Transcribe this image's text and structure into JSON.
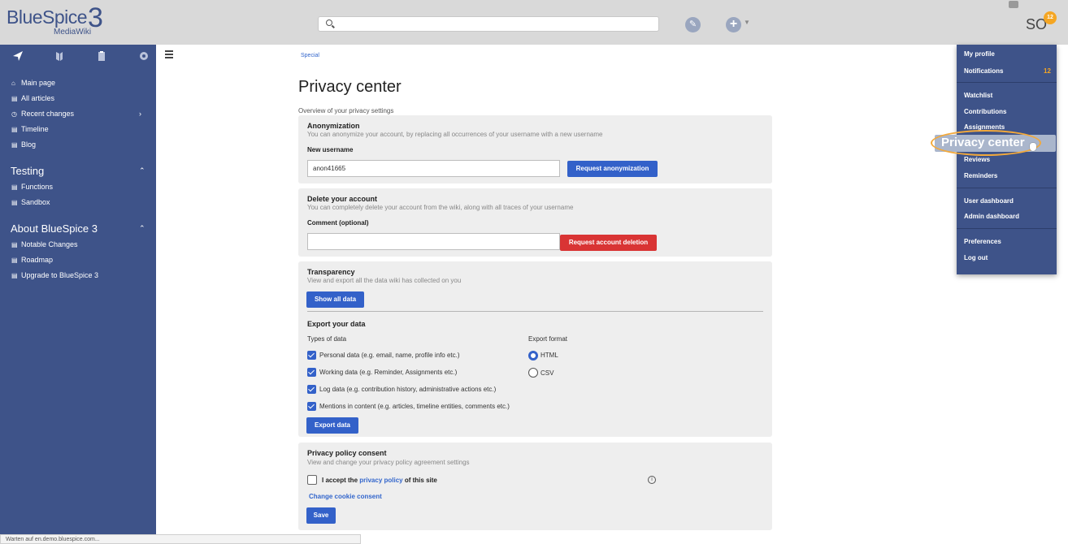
{
  "header": {
    "logo_text": "BlueSpice",
    "logo_number": "3",
    "logo_sub": "MediaWiki",
    "search_placeholder": "",
    "avatar_initials": "SO",
    "notification_count": "12"
  },
  "sidebar": {
    "items": [
      {
        "label": "Main page",
        "icon": "home-icon"
      },
      {
        "label": "All articles",
        "icon": "page-icon"
      },
      {
        "label": "Recent changes",
        "icon": "clock-icon"
      },
      {
        "label": "Timeline",
        "icon": "page-icon"
      },
      {
        "label": "Blog",
        "icon": "page-icon"
      }
    ],
    "sections": [
      {
        "title": "Testing",
        "items": [
          {
            "label": "Functions"
          },
          {
            "label": "Sandbox"
          }
        ]
      },
      {
        "title": "About BlueSpice 3",
        "items": [
          {
            "label": "Notable Changes"
          },
          {
            "label": "Roadmap"
          },
          {
            "label": "Upgrade to BlueSpice 3"
          }
        ]
      }
    ]
  },
  "main": {
    "breadcrumb": "Special",
    "title": "Privacy center",
    "subtitle": "Overview of your privacy settings",
    "anonymization": {
      "heading": "Anonymization",
      "description": "You can anonymize your account, by replacing all occurrences of your username with a new username",
      "field_label": "New username",
      "field_value": "anon41665",
      "button": "Request anonymization"
    },
    "delete": {
      "heading": "Delete your account",
      "description": "You can completely delete your account from the wiki, along with all traces of your username",
      "field_label": "Comment (optional)",
      "field_value": "",
      "button": "Request account deletion"
    },
    "transparency": {
      "heading": "Transparency",
      "description": "View and export all the data wiki has collected on you",
      "show_button": "Show all data",
      "export_heading": "Export your data",
      "types_label": "Types of data",
      "format_label": "Export format",
      "types": [
        "Personal data (e.g. email, name, profile info etc.)",
        "Working data (e.g. Reminder, Assignments etc.)",
        "Log data (e.g. contribution history, administrative actions etc.)",
        "Mentions in content (e.g. articles, timeline entities, comments etc.)"
      ],
      "formats": [
        "HTML",
        "CSV"
      ],
      "selected_format": "HTML",
      "export_button": "Export data"
    },
    "consent": {
      "heading": "Privacy policy consent",
      "description": "View and change your privacy policy agreement settings",
      "accept_prefix": "I accept the",
      "accept_link": "privacy policy",
      "accept_suffix": "of this site",
      "cookie_link": "Change cookie consent",
      "save_button": "Save"
    }
  },
  "user_menu": {
    "items": [
      "My profile",
      "Notifications",
      "Watchlist",
      "Contributions",
      "Assignments",
      "Reviews",
      "Reminders",
      "User dashboard",
      "Admin dashboard",
      "Preferences",
      "Log out"
    ],
    "notifications_count": "12",
    "highlighted": "Privacy center"
  },
  "status_bar": "Warten auf en.demo.bluespice.com...",
  "colors": {
    "brand": "#3e5389",
    "primary_button": "#3361c9",
    "danger_button": "#d93434",
    "badge": "#f5a623"
  }
}
